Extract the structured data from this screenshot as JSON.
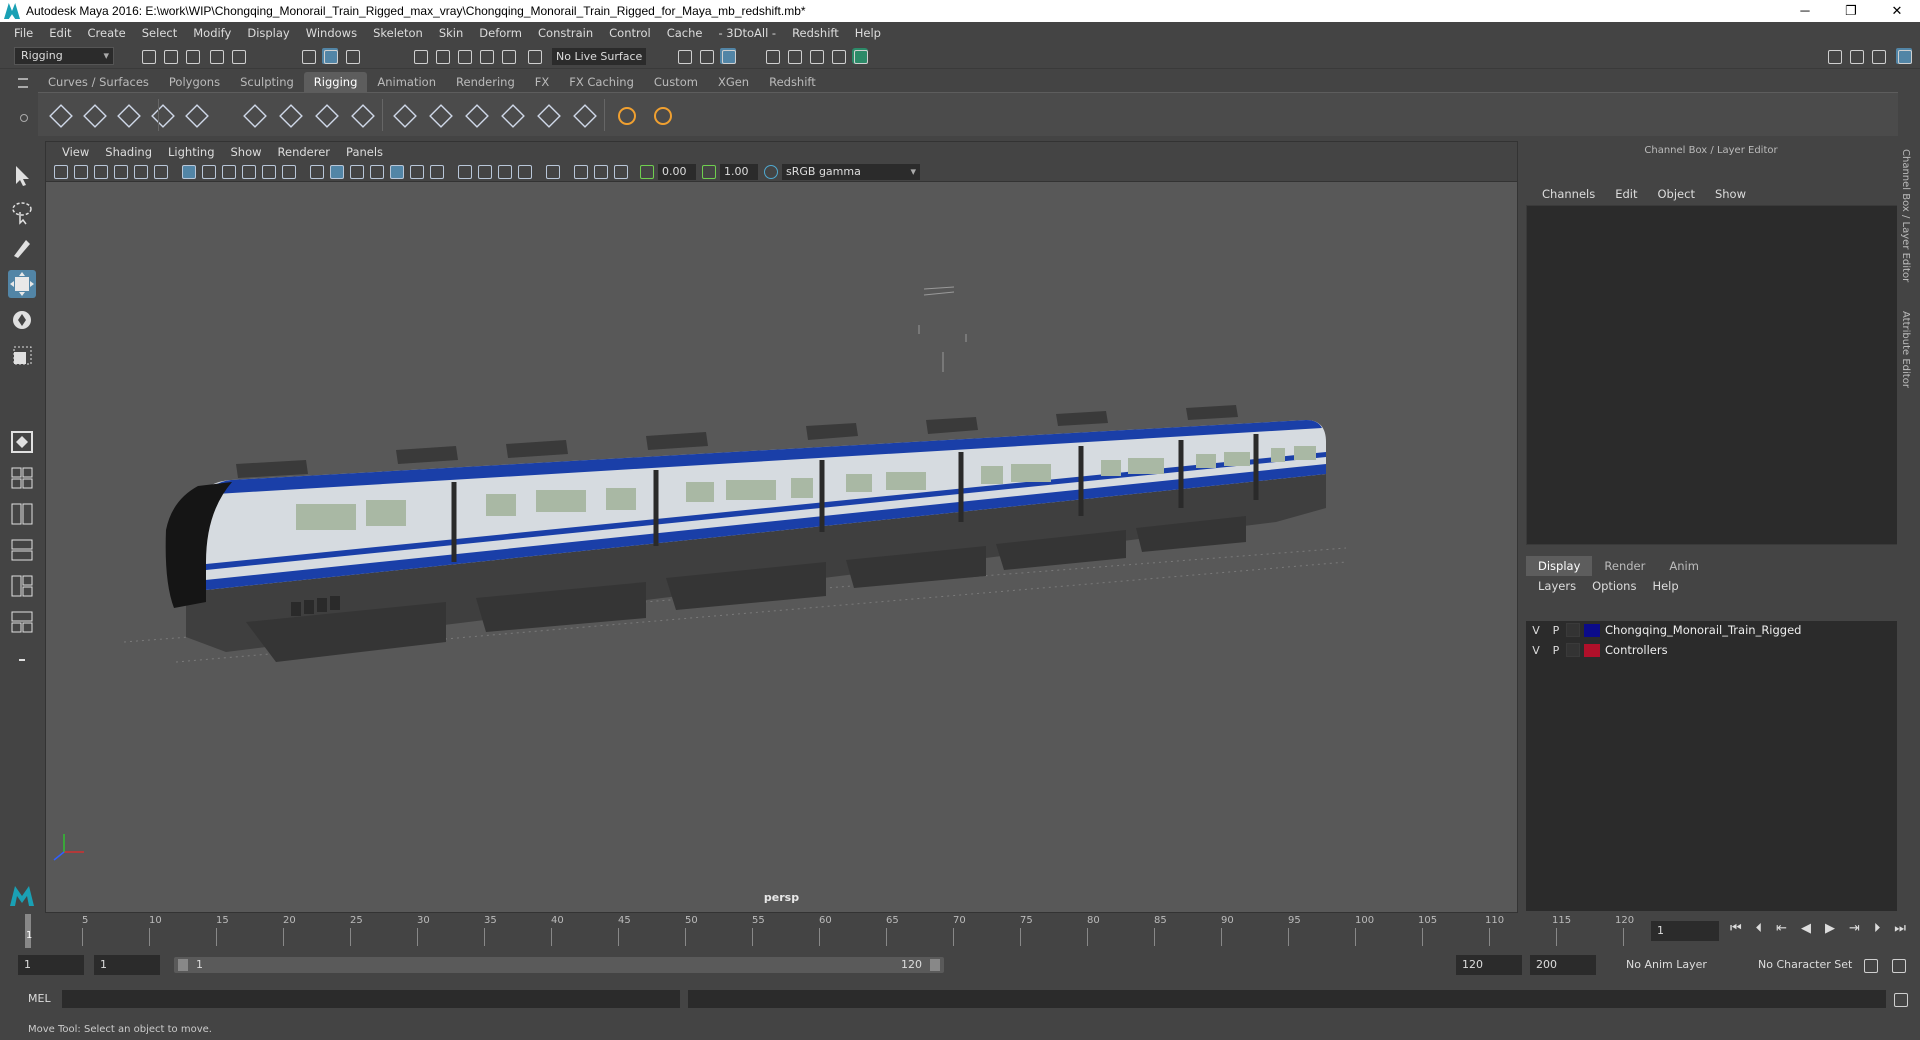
{
  "title_bar": {
    "text": "Autodesk Maya 2016: E:\\work\\WIP\\Chongqing_Monorail_Train_Rigged_max_vray\\Chongqing_Monorail_Train_Rigged_for_Maya_mb_redshift.mb*",
    "minimize": "─",
    "restore": "❐",
    "close": "✕"
  },
  "menu": [
    "File",
    "Edit",
    "Create",
    "Select",
    "Modify",
    "Display",
    "Windows",
    "Skeleton",
    "Skin",
    "Deform",
    "Constrain",
    "Control",
    "Cache",
    "- 3DtoAll -",
    "Redshift",
    "Help"
  ],
  "status_line": {
    "mode": "Rigging",
    "live_surface": "No Live Surface"
  },
  "shelf_tabs": [
    "Curves / Surfaces",
    "Polygons",
    "Sculpting",
    "Rigging",
    "Animation",
    "Rendering",
    "FX",
    "FX Caching",
    "Custom",
    "XGen",
    "Redshift"
  ],
  "active_shelf_tab": "Rigging",
  "viewport": {
    "menu": [
      "View",
      "Shading",
      "Lighting",
      "Show",
      "Renderer",
      "Panels"
    ],
    "near_value": "0.00",
    "far_value": "1.00",
    "color_space": "sRGB gamma",
    "camera_label": "persp",
    "train_colors": {
      "stripe": "#1a3fa8",
      "body": "#d6dbe0",
      "bogie": "#3f3f3f",
      "cab": "#151515"
    }
  },
  "channel_box": {
    "header": "Channel Box / Layer Editor",
    "menu": [
      "Channels",
      "Edit",
      "Object",
      "Show"
    ]
  },
  "layer_editor": {
    "tabs": [
      "Display",
      "Render",
      "Anim"
    ],
    "active_tab": "Display",
    "menu": [
      "Layers",
      "Options",
      "Help"
    ],
    "layers": [
      {
        "v": "V",
        "p": "P",
        "color": "#0b0b8a",
        "name": "Chongqing_Monorail_Train_Rigged"
      },
      {
        "v": "V",
        "p": "P",
        "color": "#b0102a",
        "name": "Controllers"
      }
    ]
  },
  "side_tabs": [
    "Channel Box / Layer Editor",
    "Attribute Editor"
  ],
  "timeline": {
    "labels": [
      "1",
      "5",
      "10",
      "15",
      "20",
      "25",
      "30",
      "35",
      "40",
      "45",
      "50",
      "55",
      "60",
      "65",
      "70",
      "75",
      "80",
      "85",
      "90",
      "95",
      "100",
      "105",
      "110",
      "115",
      "120"
    ],
    "current_frame": "1"
  },
  "range": {
    "start": "1",
    "playback_start": "1",
    "slider_start": "1",
    "slider_end": "120",
    "playback_end": "120",
    "end": "200",
    "anim_layer": "No Anim Layer",
    "character_set": "No Character Set"
  },
  "command_line": {
    "label": "MEL"
  },
  "help_line": "Move Tool: Select an object to move."
}
